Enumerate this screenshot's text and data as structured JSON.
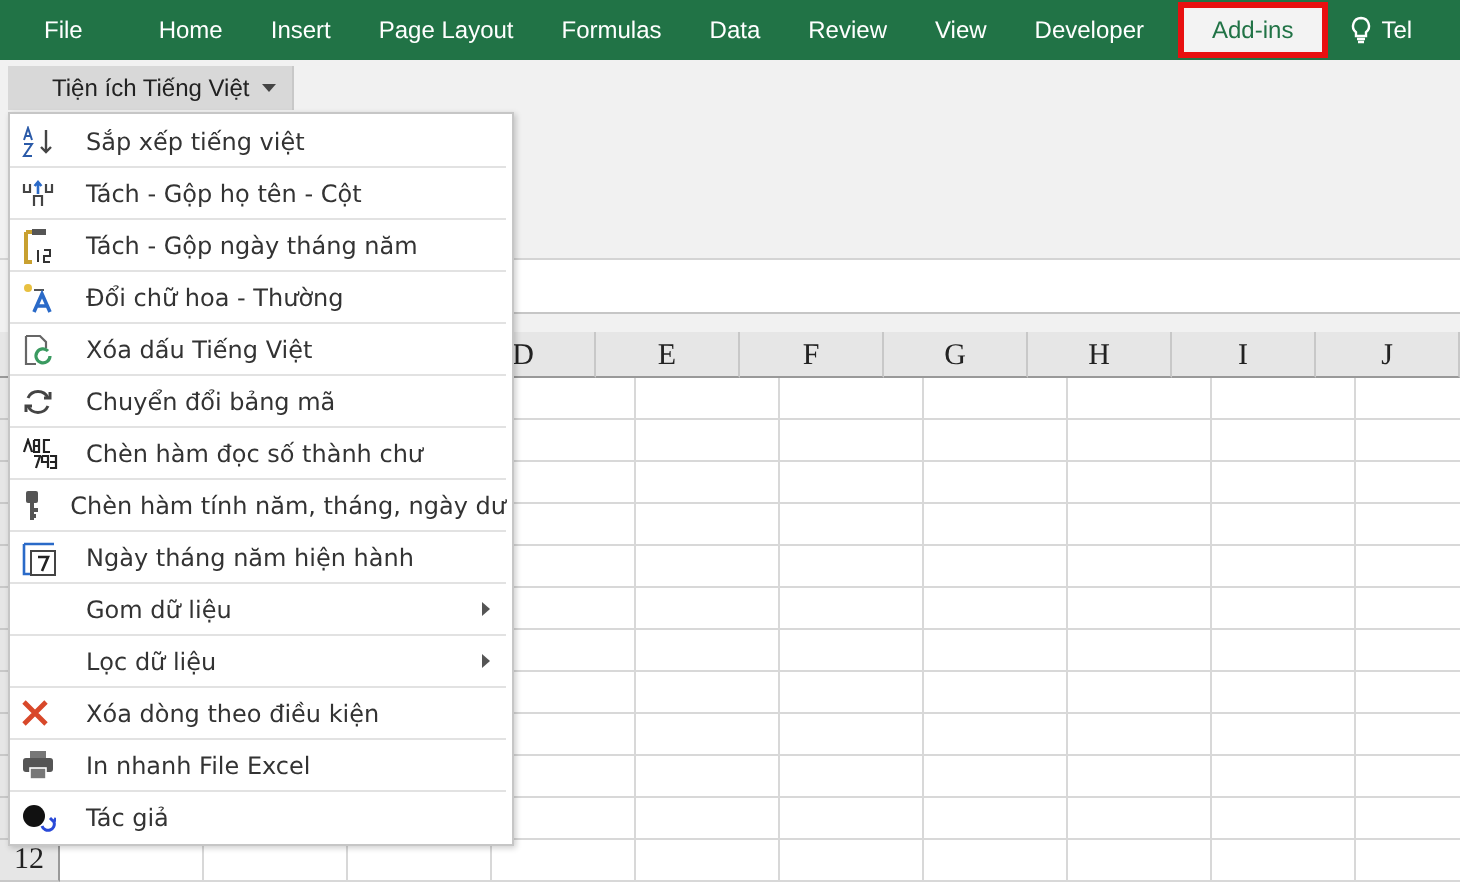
{
  "ribbon": {
    "tabs": [
      {
        "label": "File",
        "selected": false
      },
      {
        "label": "Home",
        "selected": false
      },
      {
        "label": "Insert",
        "selected": false
      },
      {
        "label": "Page Layout",
        "selected": false
      },
      {
        "label": "Formulas",
        "selected": false
      },
      {
        "label": "Data",
        "selected": false
      },
      {
        "label": "Review",
        "selected": false
      },
      {
        "label": "View",
        "selected": false
      },
      {
        "label": "Developer",
        "selected": false
      },
      {
        "label": "Add-ins",
        "selected": true
      }
    ],
    "tell_me": "Tel",
    "dropdown_button": "Tiện ích Tiếng Việt"
  },
  "menu": {
    "items": [
      {
        "label": "Sắp xếp tiếng việt",
        "submenu": false
      },
      {
        "label": "Tách - Gộp họ tên - Cột",
        "submenu": false
      },
      {
        "label": "Tách - Gộp ngày tháng năm",
        "submenu": false
      },
      {
        "label": "Đổi chữ hoa - Thường",
        "submenu": false
      },
      {
        "label": "Xóa dấu Tiếng Việt",
        "submenu": false
      },
      {
        "label": "Chuyển đổi bảng mã",
        "submenu": false
      },
      {
        "label": "Chèn hàm đọc số thành chư",
        "submenu": false
      },
      {
        "label": "Chèn hàm tính năm, tháng, ngày dư",
        "submenu": false
      },
      {
        "label": "Ngày tháng năm hiện hành",
        "submenu": false
      },
      {
        "label": "Gom dữ liệu",
        "submenu": true
      },
      {
        "label": "Lọc dữ liệu",
        "submenu": true
      },
      {
        "label": "Xóa dòng theo điều kiện",
        "submenu": false
      },
      {
        "label": "In nhanh File Excel",
        "submenu": false
      },
      {
        "label": "Tác giả",
        "submenu": false
      }
    ]
  },
  "sheet": {
    "columns": [
      "D",
      "E",
      "F",
      "G",
      "H",
      "I",
      "J"
    ],
    "row_headers": [
      "12"
    ]
  }
}
